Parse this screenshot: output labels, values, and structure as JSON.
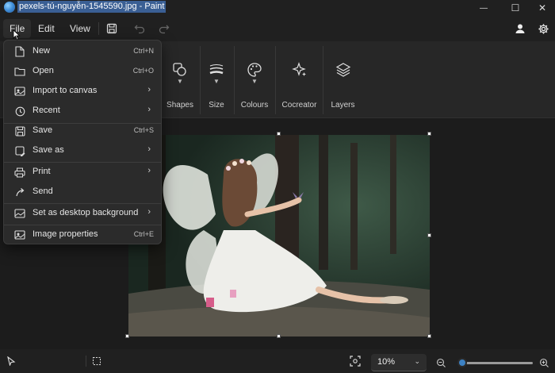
{
  "window": {
    "title": "pexels-tú-nguyễn-1545590.jpg - Paint",
    "minimize_glyph": "—",
    "maximize_glyph": "☐",
    "close_glyph": "✕"
  },
  "menubar": {
    "file": "File",
    "edit": "Edit",
    "view": "View"
  },
  "ribbon": {
    "groups": [
      {
        "label": "Shapes",
        "icon": "shapes-icon"
      },
      {
        "label": "Size",
        "icon": "size-icon"
      },
      {
        "label": "Colours",
        "icon": "palette-icon"
      },
      {
        "label": "Cocreator",
        "icon": "cocreator-sparkle-icon"
      },
      {
        "label": "Layers",
        "icon": "layers-icon"
      }
    ]
  },
  "file_menu": {
    "items": [
      {
        "label": "New",
        "shortcut": "Ctrl+N",
        "icon": "new-file-icon"
      },
      {
        "label": "Open",
        "shortcut": "Ctrl+O",
        "icon": "open-folder-icon"
      },
      {
        "label": "Import to canvas",
        "submenu": true,
        "icon": "import-icon"
      },
      {
        "label": "Recent",
        "submenu": true,
        "icon": "recent-clock-icon"
      },
      {
        "label": "Save",
        "shortcut": "Ctrl+S",
        "icon": "save-icon"
      },
      {
        "label": "Save as",
        "submenu": true,
        "icon": "save-as-icon"
      },
      {
        "label": "Print",
        "submenu": true,
        "icon": "print-icon"
      },
      {
        "label": "Send",
        "icon": "send-icon"
      },
      {
        "label": "Set as desktop background",
        "submenu": true,
        "icon": "desktop-background-icon"
      },
      {
        "label": "Image properties",
        "shortcut": "Ctrl+E",
        "icon": "image-properties-icon"
      }
    ],
    "submenu_glyph": "›"
  },
  "status": {
    "zoom": "10%",
    "zoom_dropdown_glyph": "⌄",
    "zoom_level": 0.05
  },
  "colors": {
    "accent": "#3d82c4",
    "title_highlight": "#3a5f94"
  }
}
